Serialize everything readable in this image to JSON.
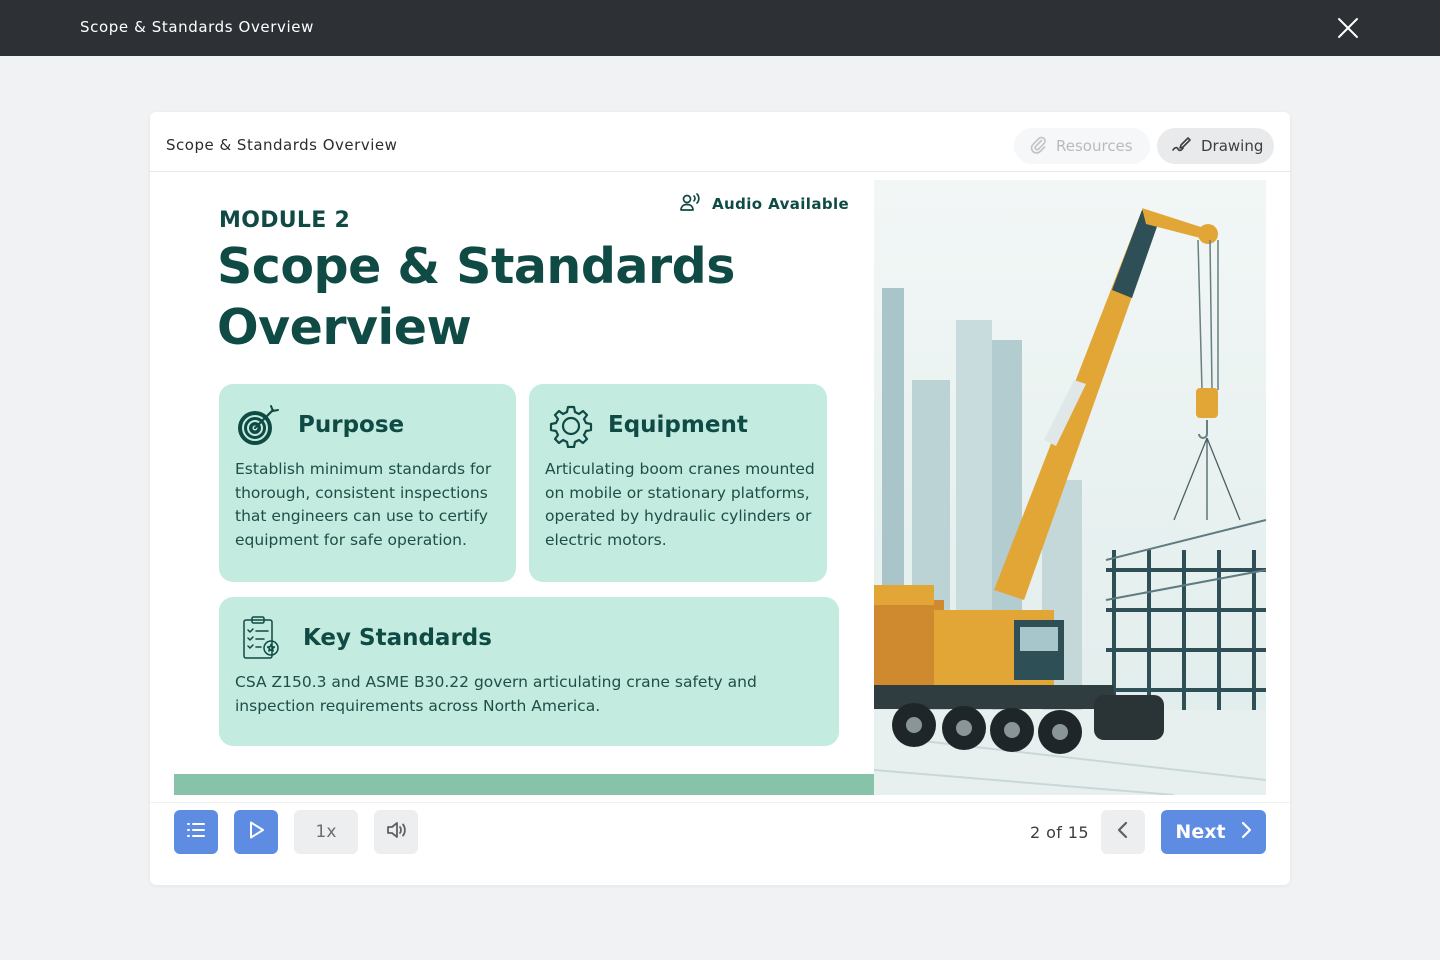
{
  "window": {
    "title": "Scope & Standards Overview",
    "close_icon": "close-icon"
  },
  "header": {
    "title": "Scope & Standards Overview",
    "resources_label": "Resources",
    "resources_icon": "paperclip-icon",
    "drawing_label": "Drawing",
    "drawing_icon": "pen-scribble-icon"
  },
  "slide": {
    "audio_label": "Audio Available",
    "module": "MODULE 2",
    "title": "Scope & Standards Overview",
    "accent_color": "#0f4a44",
    "card_color": "#c3ebdf",
    "bar_color": "#86c3a9",
    "cards": [
      {
        "icon": "target-icon",
        "title": "Purpose",
        "body": "Establish minimum standards for thorough, consistent inspections that engineers can use to certify equipment for safe operation."
      },
      {
        "icon": "gear-icon",
        "title": "Equipment",
        "body": "Articulating boom cranes mounted on mobile or stationary platforms, operated by hydraulic cylinders or electric motors."
      },
      {
        "icon": "checklist-certificate-icon",
        "title": "Key Standards",
        "body": "CSA Z150.3 and ASME B30.22 govern articulating crane safety and inspection requirements across North America."
      }
    ],
    "image": "crane-illustration"
  },
  "controls": {
    "speed": "1x",
    "page": "2 of 15",
    "next_label": "Next",
    "primary_color": "#5e8ce3"
  }
}
